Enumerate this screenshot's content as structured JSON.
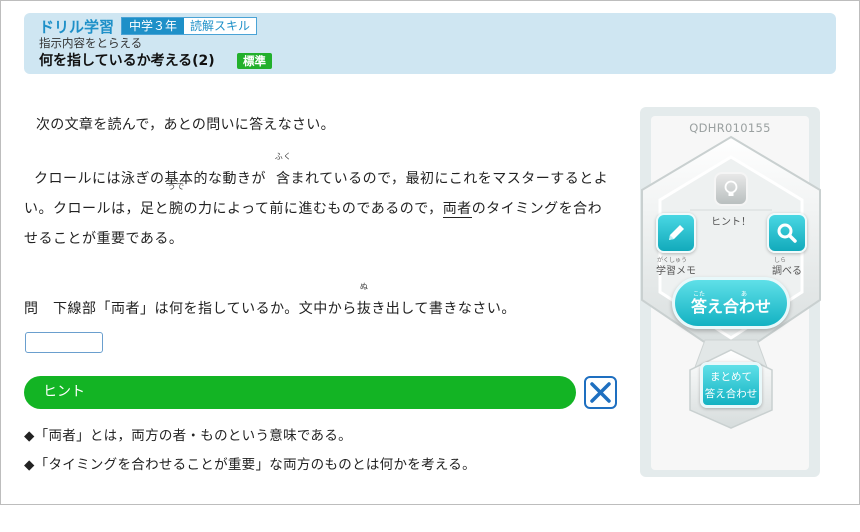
{
  "header": {
    "app_title": "ドリル学習",
    "grade": "中学３年",
    "skill": "読解スキル",
    "subtitle": "指示内容をとらえる",
    "title": "何を指しているか考える(2)",
    "level": "標準"
  },
  "instruction": "次の文章を読んで，あとの問いに答えなさい。",
  "passage": {
    "line1_a": "クロールには泳ぎの基本的な動きが",
    "kanji_fuku": "含",
    "ruby_fuku": "ふく",
    "line1_b": "まれているので，最初にこれをマスターするとよ",
    "line2_a": "い。クロールは，足と",
    "kanji_ude": "腕",
    "ruby_ude": "うで",
    "line2_b": "の力によって前に進むものであるので，",
    "underlined": "両者",
    "line2_c": "のタイミングを合わ",
    "line3": "せることが重要である。"
  },
  "question": {
    "a": "問　下線部「両者」は何を指しているか。文中から",
    "kanji_nu": "抜",
    "ruby_nu": "ぬ",
    "b": "き出して書きなさい。",
    "answer_value": ""
  },
  "hint": {
    "label": "ヒント",
    "lines": [
      "◆「両者」とは，両方の者・ものという意味である。",
      "◆「タイミングを合わせることが重要」な両方のものとは何かを考える。"
    ]
  },
  "panel": {
    "id": "QDHR010155",
    "hint_label": "ヒント！",
    "memo_label": "学習メモ",
    "memo_ruby": "がくしゅう",
    "search_label": "調べる",
    "search_ruby": "しら",
    "check_label": "答え合わせ",
    "check_ruby_1": "こた",
    "check_ruby_2": "あ",
    "summary_line1": "まとめて",
    "summary_line2": "答え合わせ",
    "accent": "#1bbccb"
  }
}
